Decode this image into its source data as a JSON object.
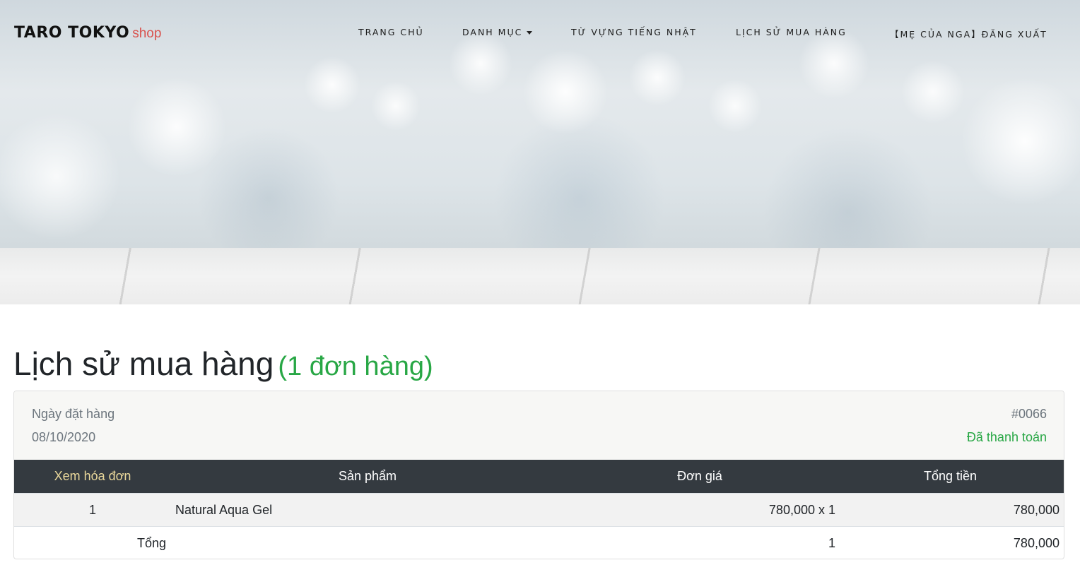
{
  "navbar": {
    "brand": "TARO TOKYO",
    "brand_suffix": "shop",
    "items": [
      {
        "label": "TRANG CHỦ"
      },
      {
        "label": "DANH MỤC"
      },
      {
        "label": "TỪ VỰNG TIẾNG NHẬT"
      },
      {
        "label": "LỊCH SỬ MUA HÀNG"
      },
      {
        "label": "【MẸ CỦA NGA】ĐĂNG XUẤT"
      }
    ]
  },
  "page": {
    "title": "Lịch sử mua hàng",
    "order_count_label": "(1 đơn hàng)"
  },
  "order": {
    "date_label": "Ngày đặt hàng",
    "date": "08/10/2020",
    "id": "#0066",
    "status": "Đã thanh toán",
    "table": {
      "headers": [
        "Xem hóa đơn",
        "Sản phẩm",
        "Đơn giá",
        "Tổng tiền"
      ],
      "rows": [
        {
          "index": "1",
          "product": "Natural Aqua Gel",
          "unit_price": "780,000 x 1",
          "total": "780,000"
        }
      ],
      "total_row": {
        "label": "Tổng",
        "quantity": "1",
        "total": "780,000"
      }
    }
  },
  "colors": {
    "accent_green": "#28a745",
    "brand_red": "#d9534f",
    "table_header_bg": "#343a40",
    "view_invoice_gold": "#ead89b"
  }
}
